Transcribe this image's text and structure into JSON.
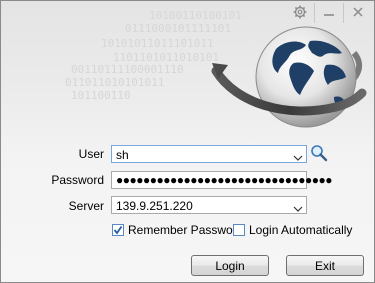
{
  "background_binary": [
    "10100110100101",
    "0111000101111101",
    "10101011011101011",
    "1101101011010101",
    "00110111100001110",
    "011011010101011",
    "101100110"
  ],
  "title_buttons": {
    "settings_icon": "gear-icon",
    "minimize_icon": "minimize-icon",
    "close_icon": "close-icon"
  },
  "form": {
    "user_label": "User",
    "user_value": "sh",
    "password_label": "Password",
    "password_value": "●●●●●●●●●●●●●●●●●●●●●●●●●●●●●●●●",
    "server_label": "Server",
    "server_value": "139.9.251.220"
  },
  "options": {
    "remember_password_label": "Remember Password",
    "remember_password_checked": true,
    "login_automatically_label": "Login Automatically",
    "login_automatically_checked": false
  },
  "buttons": {
    "login_label": "Login",
    "exit_label": "Exit"
  },
  "colors": {
    "accent_border": "#7aa7d8",
    "check_color": "#2a5d9f"
  }
}
